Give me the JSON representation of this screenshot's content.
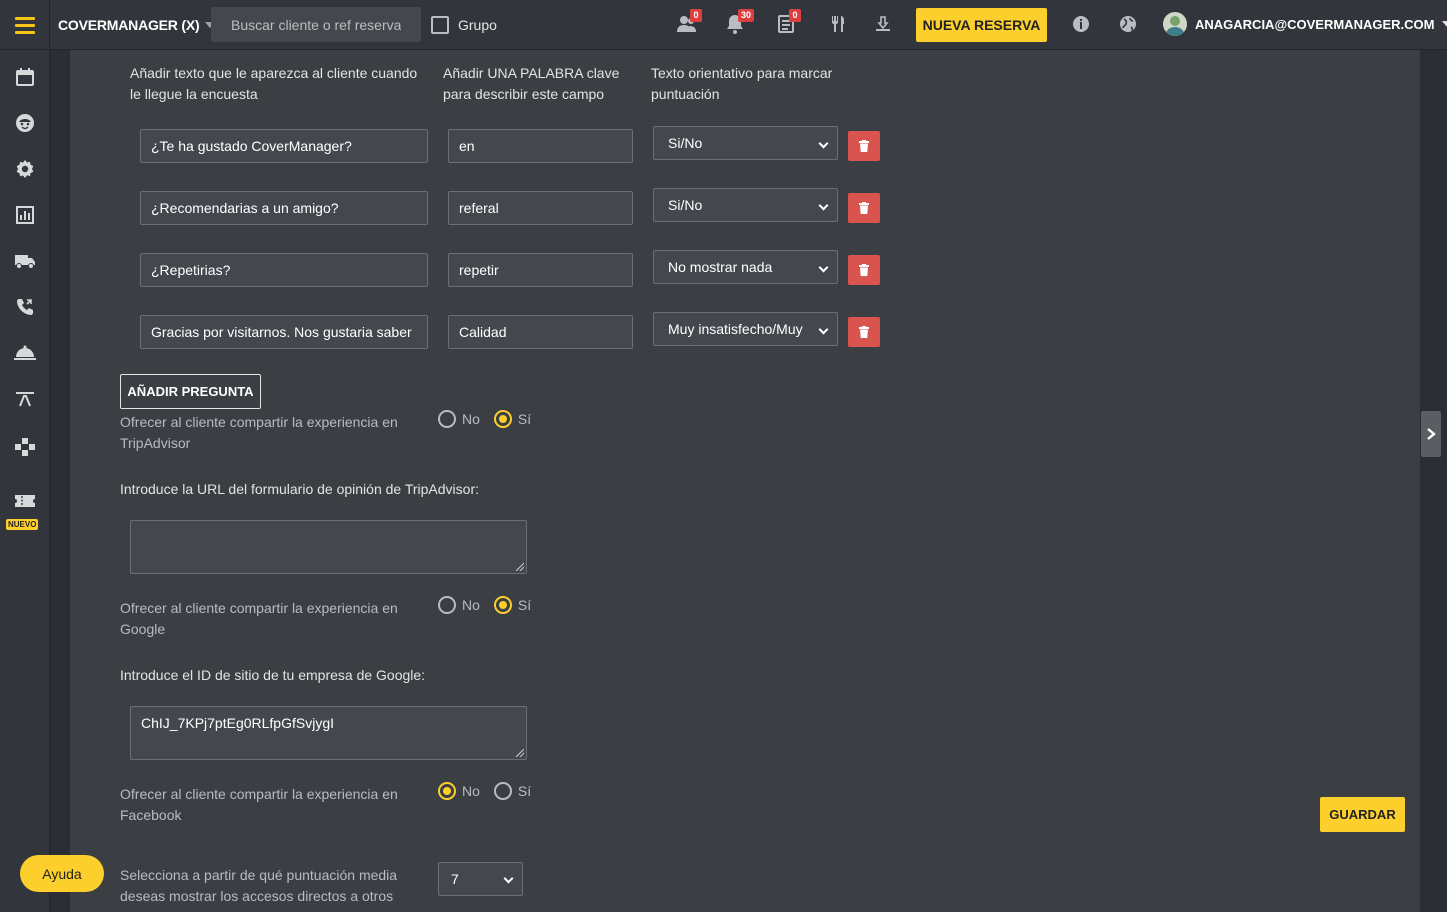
{
  "topbar": {
    "brand": "COVERMANAGER (X)",
    "search_placeholder": "Buscar cliente o ref reserva",
    "grupo_label": "Grupo",
    "badges": {
      "clients": "0",
      "notifications": "30",
      "tasks": "0"
    },
    "icons": [
      "clients-icon",
      "bell-icon",
      "list-icon",
      "cutlery-icon",
      "service-icon",
      "info-icon",
      "globe-icon"
    ],
    "new_reservation_label": "NUEVA RESERVA",
    "user_email": "ANAGARCIA@COVERMANAGER.COM"
  },
  "sidebar": {
    "items": [
      "calendar-icon",
      "face-icon",
      "gear-icon",
      "chart-icon",
      "truck-icon",
      "phone-icon",
      "cloche-icon",
      "sunset-icon",
      "gamepad-icon",
      "ticket-icon"
    ],
    "new_badge": "NUEVO"
  },
  "survey": {
    "headers": {
      "text": "Añadir texto que le aparezca al cliente cuando le llegue la encuesta",
      "keyword": "Añadir UNA PALABRA clave para describir este campo",
      "hint": "Texto orientativo para marcar puntuación"
    },
    "questions": [
      {
        "text": "¿Te ha gustado CoverManager?",
        "keyword": "en",
        "scale": "Si/No"
      },
      {
        "text": "¿Recomendarias a un amigo?",
        "keyword": "referal",
        "scale": "Si/No"
      },
      {
        "text": "¿Repetirias?",
        "keyword": "repetir",
        "scale": "No mostrar nada"
      },
      {
        "text": "Gracias por visitarnos. Nos gustaria saber",
        "keyword": "Calidad",
        "scale": "Muy insatisfecho/Muy"
      }
    ],
    "add_question_label": "AÑADIR PREGUNTA"
  },
  "share": {
    "option_no": "No",
    "option_si": "Sí",
    "tripadvisor": {
      "label": "Ofrecer al cliente compartir la experiencia en TripAdvisor",
      "selected": "si"
    },
    "tripadvisor_url_label": "Introduce la URL del formulario de opinión de TripAdvisor:",
    "tripadvisor_url_value": "",
    "google": {
      "label": "Ofrecer al cliente compartir la experiencia en Google",
      "selected": "si"
    },
    "google_id_label": "Introduce el ID de sitio de tu empresa de Google:",
    "google_id_value": "ChIJ_7KPj7ptEg0RLfpGfSvjygI",
    "facebook": {
      "label": "Ofrecer al cliente compartir la experiencia en Facebook",
      "selected": "no"
    },
    "min_score_label": "Selecciona a partir de qué puntuación media deseas mostrar los accesos directos a otros",
    "min_score_value": "7"
  },
  "actions": {
    "save_label": "GUARDAR",
    "help_label": "Ayuda"
  },
  "colors": {
    "accent": "#fccf2c",
    "danger": "#d9534f",
    "background": "#3b3f44"
  }
}
